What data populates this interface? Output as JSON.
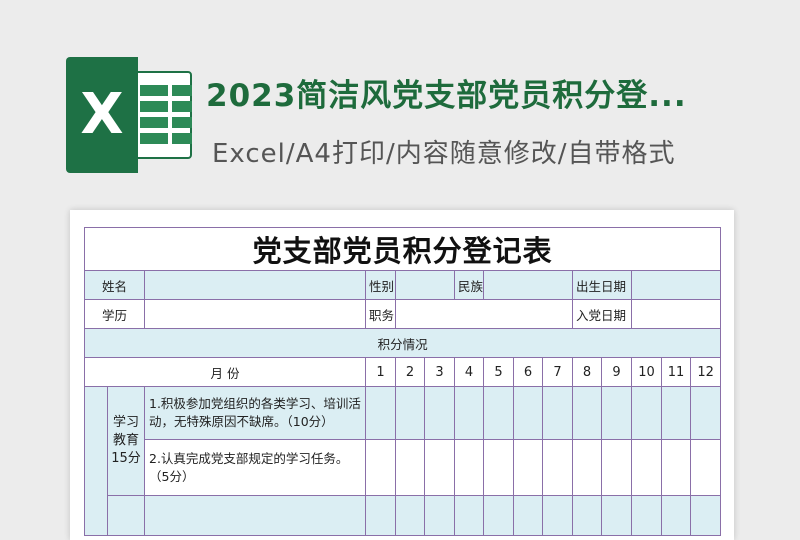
{
  "header": {
    "title": "2023简洁风党支部党员积分登...",
    "subtitle": "Excel/A4打印/内容随意修改/自带格式",
    "logo_letter": "X",
    "brand_color": "#1e7145"
  },
  "sheet": {
    "title": "党支部党员积分登记表",
    "row1": {
      "name_label": "姓名",
      "gender_label": "性别",
      "ethnicity_label": "民族",
      "birth_label": "出生日期"
    },
    "row2": {
      "edu_label": "学历",
      "position_label": "职务",
      "join_label": "入党日期"
    },
    "section_label": "积分情况",
    "month_label": "月 份",
    "months": [
      "1",
      "2",
      "3",
      "4",
      "5",
      "6",
      "7",
      "8",
      "9",
      "10",
      "11",
      "12"
    ],
    "category": {
      "label": "学习教育15分"
    },
    "tasks": [
      {
        "text": "1.积极参加党组织的各类学习、培训活动，无特殊原因不缺席。（10分）"
      },
      {
        "text": "2.认真完成党支部规定的学习任务。（5分）"
      }
    ],
    "colors": {
      "fill": "#dbeef3",
      "border": "#8a6fa8"
    }
  }
}
